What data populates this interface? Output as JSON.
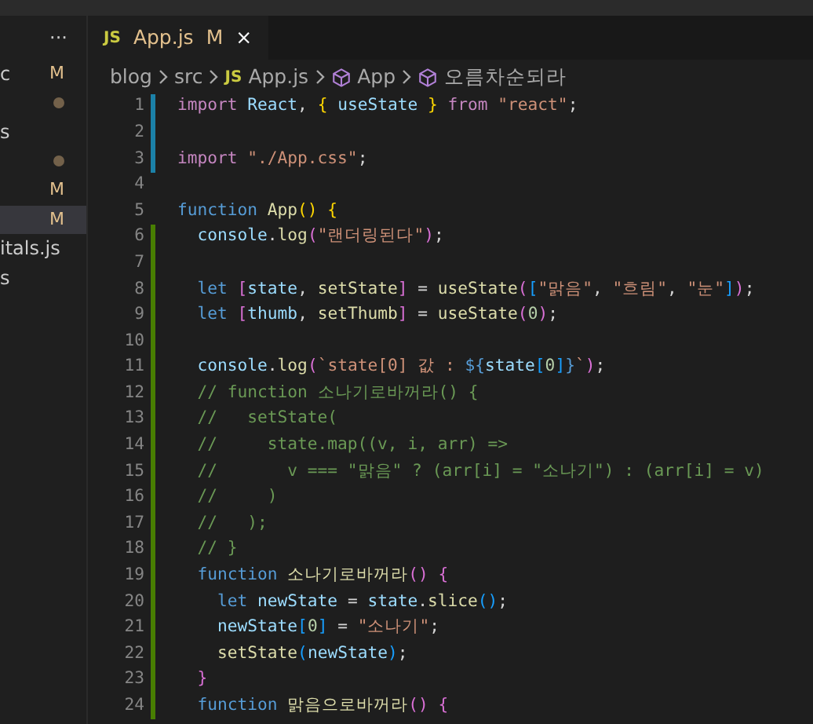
{
  "sidebar": {
    "more": "···",
    "items": [
      {
        "label": "c",
        "badge": "M",
        "kind": "modified",
        "selected": false
      },
      {
        "kind": "untracked",
        "selected": false
      },
      {
        "label": "s",
        "kind": "plain",
        "selected": false
      },
      {
        "kind": "untracked",
        "selected": false
      },
      {
        "badge": "M",
        "kind": "modified",
        "selected": false
      },
      {
        "badge": "M",
        "kind": "modified",
        "selected": true
      },
      {
        "label": "itals.js",
        "kind": "plain",
        "selected": false
      },
      {
        "label": "s",
        "kind": "plain",
        "selected": false
      }
    ]
  },
  "tabs": [
    {
      "icon": "JS",
      "label": "App.js",
      "badge": "M",
      "close": "×",
      "selected": true
    }
  ],
  "breadcrumb": [
    {
      "label": "blog",
      "kind": "folder"
    },
    {
      "label": "src",
      "kind": "folder"
    },
    {
      "label": "App.js",
      "kind": "file",
      "icon": "JS"
    },
    {
      "label": "App",
      "kind": "symbol"
    },
    {
      "label": "오름차순되라",
      "kind": "symbol"
    }
  ],
  "lines": [
    {
      "number": "1",
      "kind": "modified",
      "tokens": [
        {
          "t": "import ",
          "kind": "kw"
        },
        {
          "t": "React",
          "kind": "var"
        },
        {
          "t": ", ",
          "kind": "p"
        },
        {
          "t": "{",
          "kind": "b1"
        },
        {
          "t": " useState ",
          "kind": "var"
        },
        {
          "t": "}",
          "kind": "b1"
        },
        {
          "t": " from ",
          "kind": "kw"
        },
        {
          "t": "\"react\"",
          "kind": "str"
        },
        {
          "t": ";",
          "kind": "p"
        }
      ]
    },
    {
      "number": "2",
      "kind": "modified"
    },
    {
      "number": "3",
      "kind": "modified",
      "tokens": [
        {
          "t": "import ",
          "kind": "kw"
        },
        {
          "t": "\"./App.css\"",
          "kind": "str"
        },
        {
          "t": ";",
          "kind": "p"
        }
      ]
    },
    {
      "number": "4",
      "kind": "plain"
    },
    {
      "number": "5",
      "kind": "plain",
      "tokens": [
        {
          "t": "function ",
          "kind": "decl"
        },
        {
          "t": "App",
          "kind": "fn"
        },
        {
          "t": "() {",
          "kind": "b1"
        }
      ]
    },
    {
      "number": "6",
      "kind": "added",
      "tokens": [
        {
          "t": "  console",
          "kind": "var"
        },
        {
          "t": ".",
          "kind": "p"
        },
        {
          "t": "log",
          "kind": "fn"
        },
        {
          "t": "(",
          "kind": "b2"
        },
        {
          "t": "\"랜더링된다\"",
          "kind": "str"
        },
        {
          "t": ")",
          "kind": "b2"
        },
        {
          "t": ";",
          "kind": "p"
        }
      ]
    },
    {
      "number": "7",
      "kind": "added"
    },
    {
      "number": "8",
      "kind": "added",
      "tokens": [
        {
          "t": "  let ",
          "kind": "decl"
        },
        {
          "t": "[",
          "kind": "b2"
        },
        {
          "t": "state",
          "kind": "var"
        },
        {
          "t": ", ",
          "kind": "p"
        },
        {
          "t": "setState",
          "kind": "fn"
        },
        {
          "t": "]",
          "kind": "b2"
        },
        {
          "t": " = ",
          "kind": "p"
        },
        {
          "t": "useState",
          "kind": "fn"
        },
        {
          "t": "(",
          "kind": "b2"
        },
        {
          "t": "[",
          "kind": "b3"
        },
        {
          "t": "\"맑음\"",
          "kind": "str"
        },
        {
          "t": ", ",
          "kind": "p"
        },
        {
          "t": "\"흐림\"",
          "kind": "str"
        },
        {
          "t": ", ",
          "kind": "p"
        },
        {
          "t": "\"눈\"",
          "kind": "str"
        },
        {
          "t": "]",
          "kind": "b3"
        },
        {
          "t": ")",
          "kind": "b2"
        },
        {
          "t": ";",
          "kind": "p"
        }
      ]
    },
    {
      "number": "9",
      "kind": "added",
      "tokens": [
        {
          "t": "  let ",
          "kind": "decl"
        },
        {
          "t": "[",
          "kind": "b2"
        },
        {
          "t": "thumb",
          "kind": "var"
        },
        {
          "t": ", ",
          "kind": "p"
        },
        {
          "t": "setThumb",
          "kind": "fn"
        },
        {
          "t": "]",
          "kind": "b2"
        },
        {
          "t": " = ",
          "kind": "p"
        },
        {
          "t": "useState",
          "kind": "fn"
        },
        {
          "t": "(",
          "kind": "b2"
        },
        {
          "t": "0",
          "kind": "num"
        },
        {
          "t": ")",
          "kind": "b2"
        },
        {
          "t": ";",
          "kind": "p"
        }
      ]
    },
    {
      "number": "10",
      "kind": "added"
    },
    {
      "number": "11",
      "kind": "added",
      "tokens": [
        {
          "t": "  console",
          "kind": "var"
        },
        {
          "t": ".",
          "kind": "p"
        },
        {
          "t": "log",
          "kind": "fn"
        },
        {
          "t": "(",
          "kind": "b2"
        },
        {
          "t": "`state[0] 값 : ",
          "kind": "str"
        },
        {
          "t": "${",
          "kind": "decl"
        },
        {
          "t": "state",
          "kind": "var"
        },
        {
          "t": "[",
          "kind": "b3"
        },
        {
          "t": "0",
          "kind": "num"
        },
        {
          "t": "]",
          "kind": "b3"
        },
        {
          "t": "}",
          "kind": "decl"
        },
        {
          "t": "`",
          "kind": "str"
        },
        {
          "t": ")",
          "kind": "b2"
        },
        {
          "t": ";",
          "kind": "p"
        }
      ]
    },
    {
      "number": "12",
      "kind": "added",
      "tokens": [
        {
          "t": "  // function 소나기로바꺼라() {",
          "kind": "cm"
        }
      ]
    },
    {
      "number": "13",
      "kind": "added",
      "tokens": [
        {
          "t": "  //   setState(",
          "kind": "cm"
        }
      ]
    },
    {
      "number": "14",
      "kind": "added",
      "tokens": [
        {
          "t": "  //     state.map((v, i, arr) =>",
          "kind": "cm"
        }
      ]
    },
    {
      "number": "15",
      "kind": "added",
      "tokens": [
        {
          "t": "  //       v === \"맑음\" ? (arr[i] = \"소나기\") : (arr[i] = v)",
          "kind": "cm"
        }
      ]
    },
    {
      "number": "16",
      "kind": "added",
      "tokens": [
        {
          "t": "  //     )",
          "kind": "cm"
        }
      ]
    },
    {
      "number": "17",
      "kind": "added",
      "tokens": [
        {
          "t": "  //   );",
          "kind": "cm"
        }
      ]
    },
    {
      "number": "18",
      "kind": "added",
      "tokens": [
        {
          "t": "  // }",
          "kind": "cm"
        }
      ]
    },
    {
      "number": "19",
      "kind": "added",
      "tokens": [
        {
          "t": "  function ",
          "kind": "decl"
        },
        {
          "t": "소나기로바꺼라",
          "kind": "fn"
        },
        {
          "t": "() {",
          "kind": "b2"
        }
      ]
    },
    {
      "number": "20",
      "kind": "added",
      "tokens": [
        {
          "t": "    let ",
          "kind": "decl"
        },
        {
          "t": "newState",
          "kind": "var"
        },
        {
          "t": " = ",
          "kind": "p"
        },
        {
          "t": "state",
          "kind": "var"
        },
        {
          "t": ".",
          "kind": "p"
        },
        {
          "t": "slice",
          "kind": "fn"
        },
        {
          "t": "()",
          "kind": "b3"
        },
        {
          "t": ";",
          "kind": "p"
        }
      ]
    },
    {
      "number": "21",
      "kind": "added",
      "tokens": [
        {
          "t": "    newState",
          "kind": "var"
        },
        {
          "t": "[",
          "kind": "b3"
        },
        {
          "t": "0",
          "kind": "num"
        },
        {
          "t": "]",
          "kind": "b3"
        },
        {
          "t": " = ",
          "kind": "p"
        },
        {
          "t": "\"소나기\"",
          "kind": "str"
        },
        {
          "t": ";",
          "kind": "p"
        }
      ]
    },
    {
      "number": "22",
      "kind": "added",
      "tokens": [
        {
          "t": "    setState",
          "kind": "fn"
        },
        {
          "t": "(",
          "kind": "b3"
        },
        {
          "t": "newState",
          "kind": "var"
        },
        {
          "t": ")",
          "kind": "b3"
        },
        {
          "t": ";",
          "kind": "p"
        }
      ]
    },
    {
      "number": "23",
      "kind": "added",
      "tokens": [
        {
          "t": "  }",
          "kind": "b2"
        }
      ]
    },
    {
      "number": "24",
      "kind": "added",
      "tokens": [
        {
          "t": "  function ",
          "kind": "decl"
        },
        {
          "t": "맑음으로바꺼라",
          "kind": "fn"
        },
        {
          "t": "() {",
          "kind": "b2"
        }
      ]
    }
  ]
}
